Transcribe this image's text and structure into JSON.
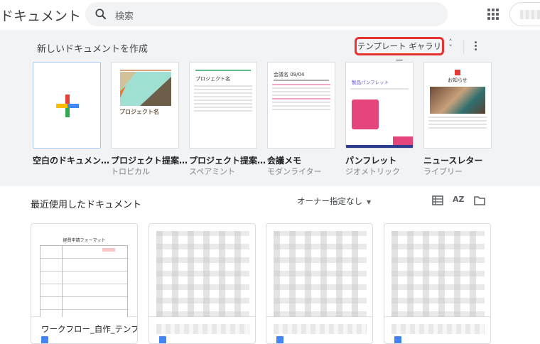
{
  "header": {
    "app_title": "ドキュメント",
    "search_placeholder": "検索"
  },
  "templates": {
    "title": "新しいドキュメントを作成",
    "gallery_label": "テンプレート ギャラリー",
    "items": [
      {
        "name": "空白のドキュメン…",
        "sub": ""
      },
      {
        "name": "プロジェクト提案…",
        "sub": "トロピカル"
      },
      {
        "name": "プロジェクト提案…",
        "sub": "スペアミント"
      },
      {
        "name": "会議メモ",
        "sub": "モダンライター"
      },
      {
        "name": "パンフレット",
        "sub": "ジオメトリック"
      },
      {
        "name": "ニュースレター",
        "sub": "ライブリー"
      }
    ],
    "thumb_text": {
      "project": "プロジェクト名",
      "meeting": "会議名 09/04",
      "brochure": "製品パンフレット",
      "news": "お知らせ"
    }
  },
  "recent": {
    "title": "最近使用したドキュメント",
    "owner_filter": "オーナー指定なし",
    "docs": [
      {
        "name": "ワークフロー_自作_テンプ…",
        "thumb_title": "経費申請フォーマット"
      }
    ]
  },
  "colors": {
    "highlight": "#e8322f",
    "doc_blue": "#4285f4"
  }
}
